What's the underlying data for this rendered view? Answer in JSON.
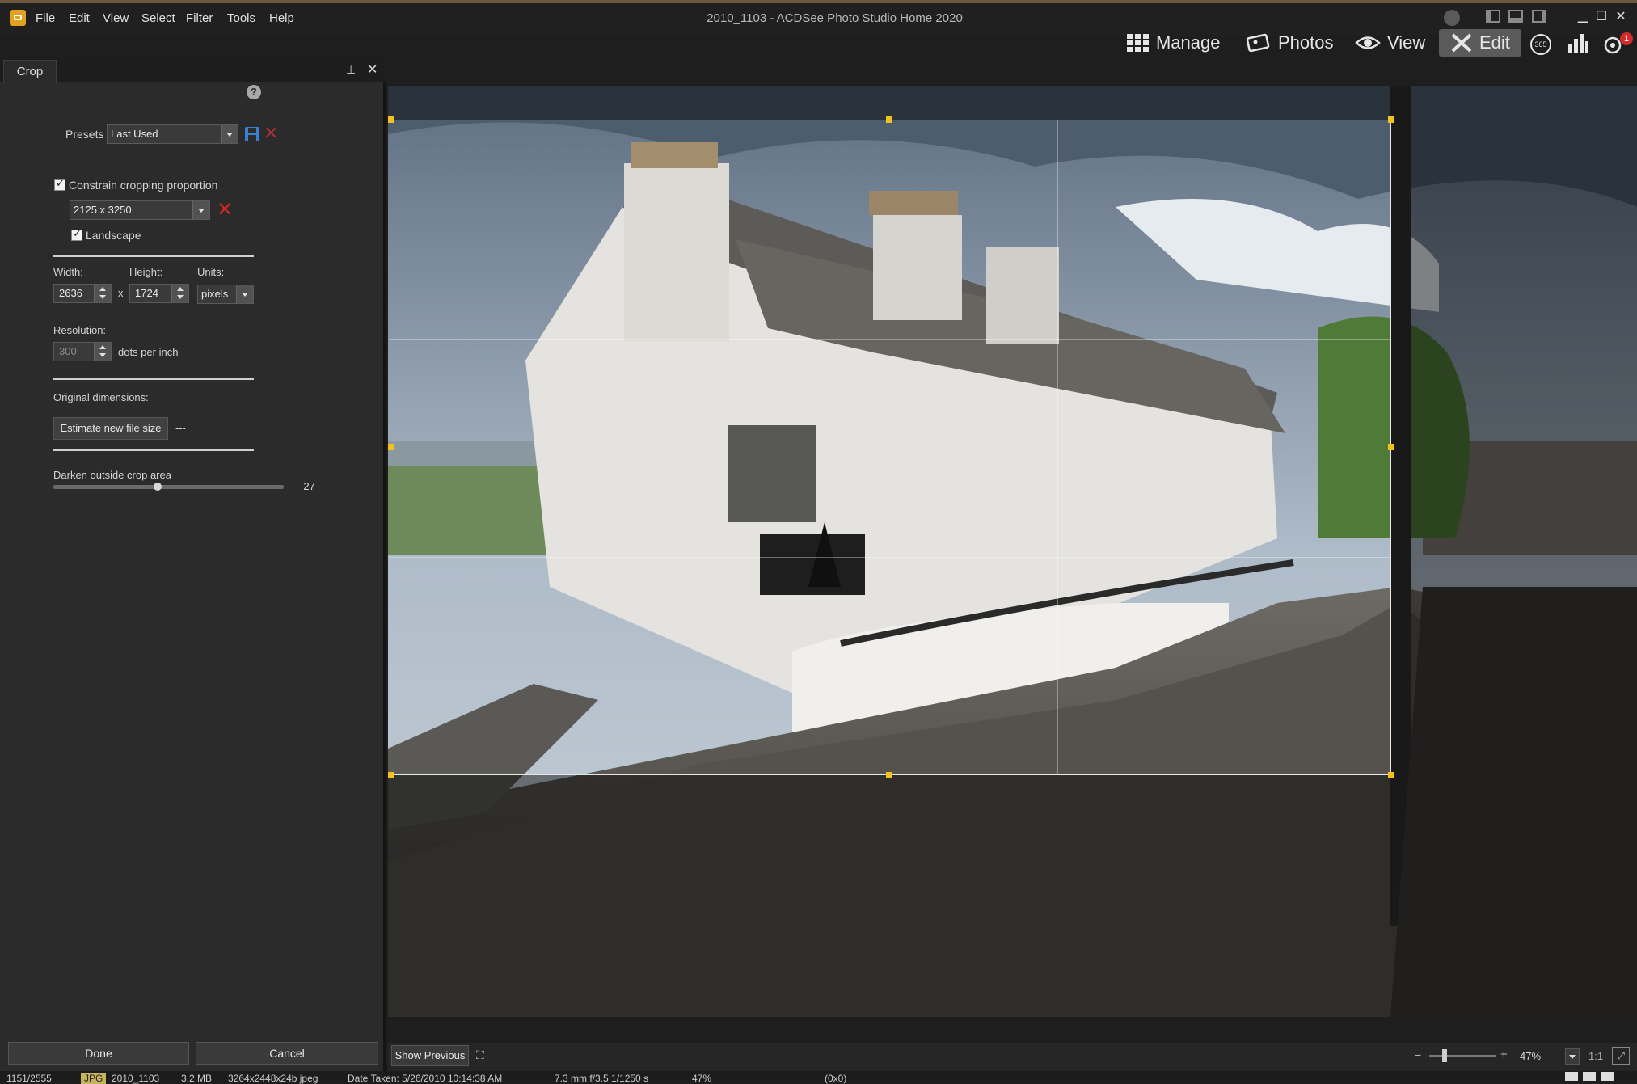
{
  "window": {
    "title": "2010_1103 - ACDSee Photo Studio Home 2020"
  },
  "menu": [
    "File",
    "Edit",
    "View",
    "Select",
    "Filter",
    "Tools",
    "Help"
  ],
  "modes": {
    "manage": "Manage",
    "photos": "Photos",
    "view": "View",
    "edit": "Edit",
    "badge": "1"
  },
  "panel": {
    "tab": "Crop",
    "presets_label": "Presets",
    "presets_value": "Last Used",
    "constrain_label": "Constrain cropping proportion",
    "proportion_value": "2125 x 3250",
    "landscape_label": "Landscape",
    "width_label": "Width:",
    "width_value": "2636",
    "height_label": "Height:",
    "height_value": "1724",
    "units_label": "Units:",
    "units_value": "pixels",
    "times": "x",
    "resolution_label": "Resolution:",
    "resolution_value": "300",
    "dpi_label": "dots per inch",
    "original_label": "Original dimensions:",
    "estimate_button": "Estimate new file size",
    "estimate_value": "---",
    "darken_label": "Darken outside crop area",
    "darken_value": "-27",
    "darken_level": 0.45,
    "done_button": "Done",
    "cancel_button": "Cancel"
  },
  "footer": {
    "show_previous": "Show Previous",
    "zoom": "47%",
    "one_to_one": "1:1"
  },
  "status": {
    "index": "1151/2555",
    "format": "JPG",
    "filename": "2010_1103",
    "size": "3.2 MB",
    "dimensions": "3264x2448x24b jpeg",
    "date_taken": "Date Taken: 5/26/2010 10:14:38 AM",
    "exif": "7.3 mm f/3.5 1/1250 s",
    "zoom": "47%",
    "coords": "(0x0)"
  }
}
